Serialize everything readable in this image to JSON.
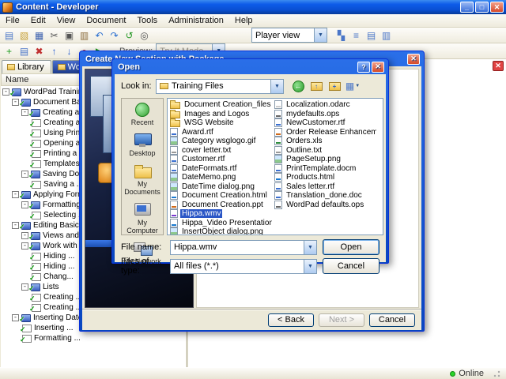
{
  "icons": {
    "minimize": "_",
    "maximize": "□",
    "close": "✕",
    "help": "?",
    "dropdown": "▼",
    "check": "✓",
    "expander": "-",
    "back_arrow": "←",
    "up_arrow": "↑",
    "new_folder_mark": "+",
    "views_grid": "▦"
  },
  "window": {
    "title": "Content - Developer",
    "menu": [
      "File",
      "Edit",
      "View",
      "Document",
      "Tools",
      "Administration",
      "Help"
    ],
    "toolbar_main": [
      {
        "name": "new-document-icon",
        "glyph": "▤",
        "color": "#4a76c8"
      },
      {
        "name": "open-icon",
        "glyph": "▧",
        "color": "#c8a23a"
      },
      {
        "name": "save-icon",
        "glyph": "▦",
        "color": "#3a5fae"
      },
      {
        "name": "cut-icon",
        "glyph": "✂",
        "color": "#555555"
      },
      {
        "name": "copy-icon",
        "glyph": "▣",
        "color": "#555555"
      },
      {
        "name": "paste-icon",
        "glyph": "▥",
        "color": "#8a6a3a"
      },
      {
        "name": "undo-icon",
        "glyph": "↶",
        "color": "#2a6fd0"
      },
      {
        "name": "redo-icon",
        "glyph": "↷",
        "color": "#2a6fd0"
      },
      {
        "name": "refresh-icon",
        "glyph": "↺",
        "color": "#2a9a2a"
      },
      {
        "name": "search-icon",
        "glyph": "◎",
        "color": "#555555"
      }
    ],
    "toolbar_main_right": [
      {
        "name": "tiles-view-icon",
        "glyph": "▚",
        "color": "#4a76c8"
      },
      {
        "name": "list-view-icon",
        "glyph": "≡",
        "color": "#4a76c8"
      },
      {
        "name": "details-view-icon",
        "glyph": "▤",
        "color": "#4a76c8"
      },
      {
        "name": "preview-pane-icon",
        "glyph": "▥",
        "color": "#4a76c8"
      }
    ],
    "toolbar_secondary": [
      {
        "name": "add-section-icon",
        "glyph": "+",
        "color": "#1a9a1a"
      },
      {
        "name": "add-topic-icon",
        "glyph": "▤",
        "color": "#4a76c8"
      },
      {
        "name": "delete-icon",
        "glyph": "✖",
        "color": "#c03030"
      },
      {
        "name": "move-up-icon",
        "glyph": "↑",
        "color": "#2a5fd0"
      },
      {
        "name": "move-down-icon",
        "glyph": "↓",
        "color": "#2a5fd0"
      },
      {
        "name": "record-icon",
        "glyph": "●",
        "color": "#c03030"
      },
      {
        "name": "play-icon",
        "glyph": "▶",
        "color": "#1a9a1a"
      }
    ],
    "player_view_value": "Player view",
    "preview_label": "Preview:",
    "preview_value": "Try It Mode",
    "status_online": "Online"
  },
  "tabs": [
    {
      "label": "Library"
    },
    {
      "label": "WordPackage"
    }
  ],
  "tree": {
    "header": "Name",
    "items": [
      {
        "depth": 0,
        "icon": "book",
        "parent": true,
        "label": "WordPad Training"
      },
      {
        "depth": 1,
        "icon": "book",
        "parent": true,
        "label": "Document Basics"
      },
      {
        "depth": 2,
        "icon": "book",
        "parent": true,
        "label": "Creating and ..."
      },
      {
        "depth": 3,
        "icon": "page",
        "parent": false,
        "label": "Creating a ..."
      },
      {
        "depth": 3,
        "icon": "page",
        "parent": false,
        "label": "Using Print ..."
      },
      {
        "depth": 3,
        "icon": "page",
        "parent": false,
        "label": "Opening a ..."
      },
      {
        "depth": 3,
        "icon": "page",
        "parent": false,
        "label": "Printing a ..."
      },
      {
        "depth": 3,
        "icon": "page",
        "parent": false,
        "label": "Templates ..."
      },
      {
        "depth": 2,
        "icon": "book",
        "parent": true,
        "label": "Saving Docu..."
      },
      {
        "depth": 3,
        "icon": "page",
        "parent": false,
        "label": "Saving a ..."
      },
      {
        "depth": 1,
        "icon": "book",
        "parent": true,
        "label": "Applying Formatti..."
      },
      {
        "depth": 2,
        "icon": "book",
        "parent": true,
        "label": "Formatting Pa..."
      },
      {
        "depth": 3,
        "icon": "page",
        "parent": false,
        "label": "Selecting ..."
      },
      {
        "depth": 1,
        "icon": "book",
        "parent": true,
        "label": "Editing Basics"
      },
      {
        "depth": 2,
        "icon": "book",
        "parent": true,
        "label": "Views and Too..."
      },
      {
        "depth": 2,
        "icon": "book",
        "parent": true,
        "label": "Work with ..."
      },
      {
        "depth": 3,
        "icon": "page",
        "parent": false,
        "label": "Hiding ..."
      },
      {
        "depth": 3,
        "icon": "page",
        "parent": false,
        "label": "Hiding ..."
      },
      {
        "depth": 3,
        "icon": "page",
        "parent": false,
        "label": "Chang..."
      },
      {
        "depth": 2,
        "icon": "book",
        "parent": true,
        "label": "Lists"
      },
      {
        "depth": 3,
        "icon": "page",
        "parent": false,
        "label": "Creating ..."
      },
      {
        "depth": 3,
        "icon": "page",
        "parent": false,
        "label": "Creating ..."
      },
      {
        "depth": 1,
        "icon": "book",
        "parent": true,
        "label": "Inserting Date..."
      },
      {
        "depth": 2,
        "icon": "page",
        "parent": false,
        "label": "Inserting ..."
      },
      {
        "depth": 2,
        "icon": "page",
        "parent": false,
        "label": "Formatting ..."
      }
    ]
  },
  "wizard_dialog": {
    "title": "Create New Section with Package",
    "back_label": "< Back",
    "next_label": "Next >",
    "cancel_label": "Cancel"
  },
  "open_dialog": {
    "title": "Open",
    "look_in_label": "Look in:",
    "look_in_value": "Training Files",
    "places": [
      {
        "label": "Recent",
        "icon": "recent-icon"
      },
      {
        "label": "Desktop",
        "icon": "desktop-icon"
      },
      {
        "label": "My Documents",
        "icon": "mydocs-icon"
      },
      {
        "label": "My Computer",
        "icon": "mycomputer-icon"
      },
      {
        "label": "My Network",
        "icon": "mynetwork-icon"
      }
    ],
    "files_col1": [
      {
        "label": "Document Creation_files",
        "icon": "folder",
        "selected": false
      },
      {
        "label": "Images and Logos",
        "icon": "folder",
        "selected": false
      },
      {
        "label": "WSG Website",
        "icon": "folder",
        "selected": false
      },
      {
        "label": "Award.rtf",
        "icon": "doc",
        "selected": false
      },
      {
        "label": "Category wsglogo.gif",
        "icon": "image",
        "selected": false
      },
      {
        "label": "cover letter.txt",
        "icon": "text",
        "selected": false
      },
      {
        "label": "Customer.rtf",
        "icon": "doc",
        "selected": false
      },
      {
        "label": "DateFormats.rtf",
        "icon": "doc",
        "selected": false
      },
      {
        "label": "DateMemo.png",
        "icon": "image",
        "selected": false
      },
      {
        "label": "DateTime dialog.png",
        "icon": "image",
        "selected": false
      },
      {
        "label": "Document Creation.html",
        "icon": "html",
        "selected": false
      },
      {
        "label": "Document Creation.ppt",
        "icon": "ppt",
        "selected": false
      },
      {
        "label": "Hippa.wmv",
        "icon": "media",
        "selected": true
      },
      {
        "label": "Hippa_Video Presentation.html",
        "icon": "html",
        "selected": false
      },
      {
        "label": "InsertObject dialog.png",
        "icon": "image",
        "selected": false
      }
    ],
    "files_col2": [
      {
        "label": "Localization.odarc",
        "icon": "generic",
        "selected": false
      },
      {
        "label": "mydefaults.ops",
        "icon": "ops",
        "selected": false
      },
      {
        "label": "NewCustomer.rtf",
        "icon": "doc",
        "selected": false
      },
      {
        "label": "Order Release Enhancements.ppt",
        "icon": "ppt",
        "selected": false
      },
      {
        "label": "Orders.xls",
        "icon": "xls",
        "selected": false
      },
      {
        "label": "Outline.txt",
        "icon": "text",
        "selected": false
      },
      {
        "label": "PageSetup.png",
        "icon": "image",
        "selected": false
      },
      {
        "label": "PrintTemplate.docm",
        "icon": "doc",
        "selected": false
      },
      {
        "label": "Products.html",
        "icon": "html",
        "selected": false
      },
      {
        "label": "Sales letter.rtf",
        "icon": "doc",
        "selected": false
      },
      {
        "label": "Translation_done.doc",
        "icon": "doc",
        "selected": false
      },
      {
        "label": "WordPad defaults.ops",
        "icon": "ops",
        "selected": false
      }
    ],
    "file_name_label": "File name:",
    "file_name_value": "Hippa.wmv",
    "file_type_label": "Files of type:",
    "file_type_value": "All files (*.*)",
    "open_label": "Open",
    "cancel_label": "Cancel"
  }
}
